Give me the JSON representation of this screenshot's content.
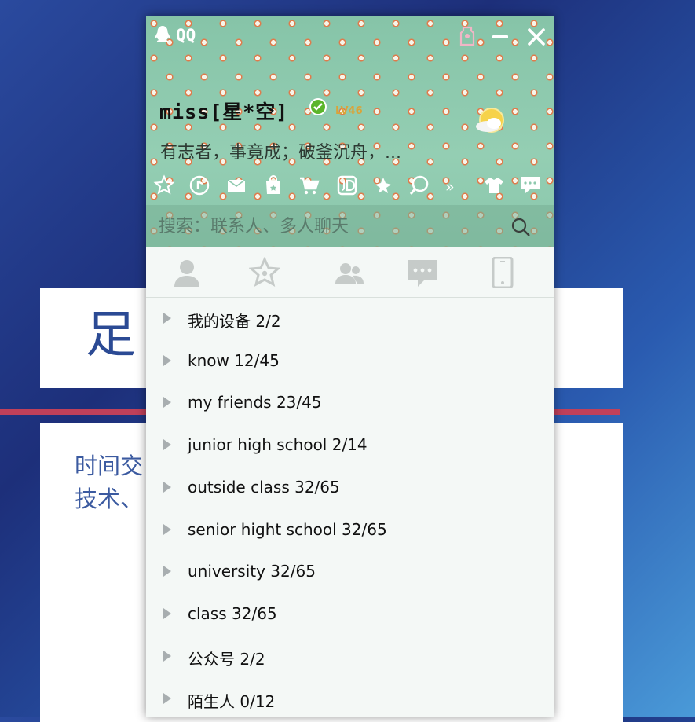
{
  "background_slide": {
    "title_fragment": "足",
    "body_line_1": "时间交",
    "body_line_2": "技术、"
  },
  "qq_window": {
    "title": "QQ",
    "profile": {
      "nickname": "miss[星*空]",
      "level_badge": "LV46",
      "signature": "有志者，事竟成；破釜沉舟，..."
    },
    "toolbar_icons": [
      "star-icon",
      "music-icon",
      "mail-icon",
      "shop-bag-icon",
      "cart-icon",
      "jd-icon",
      "apps-icon",
      "search-circle-icon",
      "shirt-icon",
      "message-icon"
    ],
    "toolbar_more": "»",
    "search": {
      "placeholder": "搜索：联系人、多人聊天"
    },
    "tabs": [
      "contacts-tab",
      "favorites-tab",
      "groups-tab",
      "conversations-tab",
      "phone-tab"
    ],
    "groups": [
      {
        "label": "我的设备 2/2"
      },
      {
        "label": "know 12/45"
      },
      {
        "label": "my friends 23/45"
      },
      {
        "label": "junior high school 2/14"
      },
      {
        "label": "outside class 32/65"
      },
      {
        "label": "senior hight school 32/65"
      },
      {
        "label": "university 32/65"
      },
      {
        "label": "class 32/65"
      },
      {
        "label": "公众号 2/2"
      },
      {
        "label": "陌生人 0/12"
      }
    ],
    "colors": {
      "header_green": "#8dc9ad",
      "verified_green": "#5bb52a",
      "level_gold": "#d9a43a"
    }
  }
}
